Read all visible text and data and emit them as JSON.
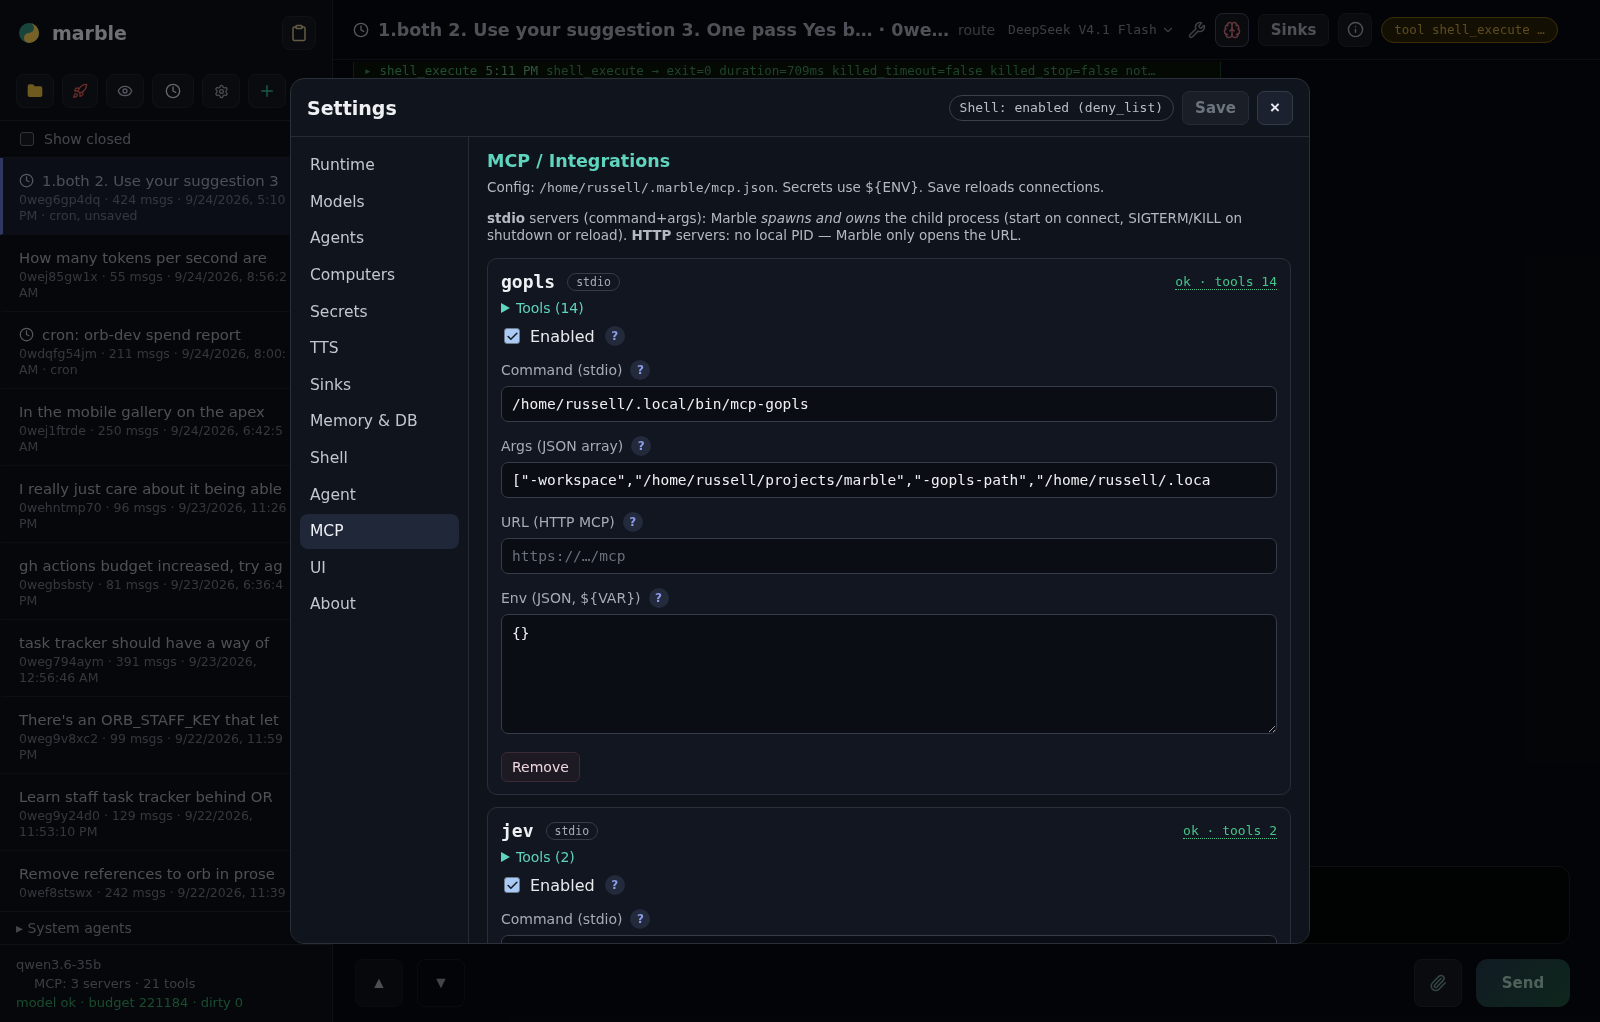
{
  "sidebar": {
    "brand": "marble",
    "show_closed": {
      "label": "Show closed",
      "checked": false
    },
    "sessions": [
      {
        "title": "1.both 2. Use your suggestion 3",
        "meta": [
          "0weg6gp4dq · 424 msgs · 9/24/2026, 5:10",
          "PM · cron, unsaved"
        ],
        "cron": true,
        "selected": true
      },
      {
        "title": "How many tokens per second are",
        "meta": [
          "0wej85gw1x · 55 msgs · 9/24/2026, 8:56:2",
          "AM"
        ],
        "cron": false,
        "selected": false
      },
      {
        "title": "cron: orb-dev spend report",
        "meta": [
          "0wdqfg54jm · 211 msgs · 9/24/2026, 8:00:",
          "AM · cron"
        ],
        "cron": true,
        "selected": false
      },
      {
        "title": "In the mobile gallery on the apex",
        "meta": [
          "0wej1ftrde · 250 msgs · 9/24/2026, 6:42:5",
          "AM"
        ],
        "cron": false,
        "selected": false
      },
      {
        "title": "I really just care about it being able",
        "meta": [
          "0wehntmp70 · 96 msgs · 9/23/2026, 11:26",
          "PM"
        ],
        "cron": false,
        "selected": false
      },
      {
        "title": "gh actions budget increased, try ag",
        "meta": [
          "0wegbsbsty · 81 msgs · 9/23/2026, 6:36:4",
          "PM"
        ],
        "cron": false,
        "selected": false
      },
      {
        "title": "task tracker should have a way of",
        "meta": [
          "0weg794aym · 391 msgs · 9/23/2026,",
          "12:56:46 AM"
        ],
        "cron": false,
        "selected": false
      },
      {
        "title": "There's an ORB_STAFF_KEY that let",
        "meta": [
          "0weg9v8xc2 · 99 msgs · 9/22/2026, 11:59",
          "PM"
        ],
        "cron": false,
        "selected": false
      },
      {
        "title": "Learn staff task tracker behind OR",
        "meta": [
          "0weg9y24d0 · 129 msgs · 9/22/2026,",
          "11:53:10 PM"
        ],
        "cron": false,
        "selected": false
      },
      {
        "title": "Remove references to orb in prose",
        "meta": [
          "0wef8stswx · 242 msgs · 9/22/2026, 11:39"
        ],
        "cron": false,
        "selected": false
      }
    ],
    "system_agents": "System agents",
    "model": "qwen3.6-35b",
    "mcp_summary": "MCP: 3 servers · 21 tools",
    "status": "model ok · budget 221184 · dirty 0"
  },
  "topbar": {
    "title": "1.both 2. Use your suggestion 3. One pass Yes b… · 0we…",
    "route": "route",
    "model": "DeepSeek V4.1 Flash",
    "sinks": "Sinks",
    "tool_badge": "tool shell_execute …"
  },
  "log": {
    "arrow": "▸",
    "tool": "shell_execute",
    "time": "5:11 PM",
    "text": "shell_execute → exit=0 duration=709ms killed_timeout=false killed_stop=false not…"
  },
  "composer": {
    "up": "▲",
    "down": "▼",
    "send": "Send"
  },
  "settings": {
    "title": "Settings",
    "shell_badge": "Shell: enabled (deny_list)",
    "save": "Save",
    "close": "×",
    "nav": [
      {
        "label": "Runtime",
        "selected": false
      },
      {
        "label": "Models",
        "selected": false
      },
      {
        "label": "Agents",
        "selected": false
      },
      {
        "label": "Computers",
        "selected": false
      },
      {
        "label": "Secrets",
        "selected": false
      },
      {
        "label": "TTS",
        "selected": false
      },
      {
        "label": "Sinks",
        "selected": false
      },
      {
        "label": "Memory & DB",
        "selected": false
      },
      {
        "label": "Shell",
        "selected": false
      },
      {
        "label": "Agent",
        "selected": false
      },
      {
        "label": "MCP",
        "selected": true
      },
      {
        "label": "UI",
        "selected": false
      },
      {
        "label": "About",
        "selected": false
      }
    ],
    "heading": "MCP / Integrations",
    "config": {
      "prefix": "Config: ",
      "path": "/home/russell/.marble/mcp.json",
      "suffix": ". Secrets use ${ENV}. Save reloads connections."
    },
    "description": "**stdio** servers (command+args): Marble *spawns and owns* the child process (start on connect, SIGTERM/KILL on shutdown or reload). **HTTP** servers: no local PID — Marble only opens the URL.",
    "servers": [
      {
        "name": "gopls",
        "transport": "stdio",
        "status": "ok · tools 14",
        "tools": "Tools (14)",
        "enabled": {
          "label": "Enabled",
          "checked": true,
          "help": "?"
        },
        "fields": [
          {
            "kind": "input",
            "label": "Command (stdio)",
            "help": "?",
            "value": "/home/russell/.local/bin/mcp-gopls"
          },
          {
            "kind": "input",
            "label": "Args (JSON array)",
            "help": "?",
            "value": "[\"-workspace\",\"/home/russell/projects/marble\",\"-gopls-path\",\"/home/russell/.loca"
          },
          {
            "kind": "input",
            "label": "URL (HTTP MCP)",
            "help": "?",
            "placeholder": "https://…/mcp"
          },
          {
            "kind": "textarea",
            "label": "Env (JSON, ${VAR})",
            "help": "?",
            "value": "{}"
          }
        ],
        "remove": "Remove"
      },
      {
        "name": "jev",
        "transport": "stdio",
        "status": "ok · tools 2",
        "tools": "Tools (2)",
        "enabled": {
          "label": "Enabled",
          "checked": true,
          "help": "?"
        },
        "fields": [
          {
            "kind": "input",
            "label": "Command (stdio)",
            "help": "?"
          }
        ]
      }
    ]
  }
}
